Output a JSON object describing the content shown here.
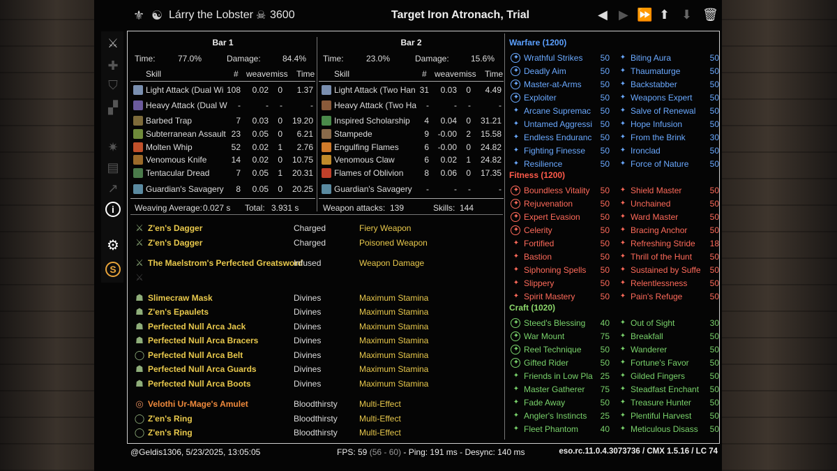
{
  "header": {
    "player": "Lárry the Lobster",
    "dps": "3600",
    "target": "Target Iron Atronach, Trial"
  },
  "colors": {
    "blue": "#6aa9ff",
    "red": "#ff6a5a",
    "green": "#79d26b",
    "gold": "#e9c94c",
    "orange": "#f08a3c",
    "header_blue": "#5ba0ff",
    "header_red": "#ff5a4a",
    "header_green": "#8cd86b"
  },
  "bars": [
    {
      "title": "Bar 1",
      "time_label": "Time:",
      "time": "77.0%",
      "damage_label": "Damage:",
      "damage": "84.4%",
      "cols": [
        "Skill",
        "#",
        "weave",
        "miss",
        "Time"
      ],
      "skills": [
        {
          "name": "Light Attack (Dual Wi",
          "n": "108",
          "weave": "0.02",
          "miss": "0",
          "time": "1.37",
          "color": "#7a8fb0"
        },
        {
          "name": "Heavy Attack (Dual W",
          "n": "-",
          "weave": "-",
          "miss": "-",
          "time": "-",
          "color": "#6b5a9c"
        },
        {
          "name": "Barbed Trap",
          "n": "7",
          "weave": "0.03",
          "miss": "0",
          "time": "19.20",
          "color": "#7d6a3a"
        },
        {
          "name": "Subterranean Assault",
          "n": "23",
          "weave": "0.05",
          "miss": "0",
          "time": "6.21",
          "color": "#6f8a3a"
        },
        {
          "name": "Molten Whip",
          "n": "52",
          "weave": "0.02",
          "miss": "1",
          "time": "2.76",
          "color": "#c0502a"
        },
        {
          "name": "Venomous Knife",
          "n": "14",
          "weave": "0.02",
          "miss": "0",
          "time": "10.75",
          "color": "#9a6a2a"
        },
        {
          "name": "Tentacular Dread",
          "n": "7",
          "weave": "0.05",
          "miss": "1",
          "time": "20.31",
          "color": "#4a7a4a"
        },
        {
          "name": "Guardian's Savagery",
          "n": "8",
          "weave": "0.05",
          "miss": "0",
          "time": "20.25",
          "color": "#5a8aa0"
        }
      ],
      "footer_a_label": "Weaving Average:",
      "footer_a": "0.027 s",
      "footer_b_label": "Total:",
      "footer_b": "3.931 s"
    },
    {
      "title": "Bar 2",
      "time_label": "Time:",
      "time": "23.0%",
      "damage_label": "Damage:",
      "damage": "15.6%",
      "cols": [
        "Skill",
        "#",
        "weave",
        "miss",
        "Time"
      ],
      "skills": [
        {
          "name": "Light Attack (Two Han",
          "n": "31",
          "weave": "0.03",
          "miss": "0",
          "time": "4.49",
          "color": "#7a8fb0"
        },
        {
          "name": "Heavy Attack (Two Ha",
          "n": "-",
          "weave": "-",
          "miss": "-",
          "time": "-",
          "color": "#8a5a3a"
        },
        {
          "name": "Inspired Scholarship",
          "n": "4",
          "weave": "0.04",
          "miss": "0",
          "time": "31.21",
          "color": "#4a8a4a"
        },
        {
          "name": "Stampede",
          "n": "9",
          "weave": "-0.00",
          "miss": "2",
          "time": "15.58",
          "color": "#8a6a4a"
        },
        {
          "name": "Engulfing Flames",
          "n": "6",
          "weave": "-0.00",
          "miss": "0",
          "time": "24.82",
          "color": "#d07a2a"
        },
        {
          "name": "Venomous Claw",
          "n": "6",
          "weave": "0.02",
          "miss": "1",
          "time": "24.82",
          "color": "#c08a2a"
        },
        {
          "name": "Flames of Oblivion",
          "n": "8",
          "weave": "0.06",
          "miss": "0",
          "time": "17.35",
          "color": "#c0402a"
        },
        {
          "name": "Guardian's Savagery",
          "n": "-",
          "weave": "-",
          "miss": "-",
          "time": "-",
          "color": "#5a8aa0"
        }
      ],
      "footer_a_label": "Weapon attacks:",
      "footer_a": "139",
      "footer_b_label": "Skills:",
      "footer_b": "144"
    }
  ],
  "gear": [
    {
      "name": "Z'en's Dagger",
      "trait": "Charged",
      "enchant": "Fiery Weapon",
      "color": "#e9c94c",
      "icon": "⚔"
    },
    {
      "name": "Z'en's Dagger",
      "trait": "Charged",
      "enchant": "Poisoned Weapon",
      "color": "#e9c94c",
      "icon": "⚔"
    },
    {
      "name": "The Maelstrom's Perfected Greatsword",
      "trait": "Infused",
      "enchant": "Weapon Damage",
      "color": "#e9c94c",
      "icon": "⚔"
    },
    {
      "name": "Slimecraw Mask",
      "trait": "Divines",
      "enchant": "Maximum Stamina",
      "color": "#e9c94c",
      "icon": "☗"
    },
    {
      "name": "Z'en's Epaulets",
      "trait": "Divines",
      "enchant": "Maximum Stamina",
      "color": "#e9c94c",
      "icon": "☗"
    },
    {
      "name": "Perfected Null Arca Jack",
      "trait": "Divines",
      "enchant": "Maximum Stamina",
      "color": "#e9c94c",
      "icon": "☗"
    },
    {
      "name": "Perfected Null Arca Bracers",
      "trait": "Divines",
      "enchant": "Maximum Stamina",
      "color": "#e9c94c",
      "icon": "☗"
    },
    {
      "name": "Perfected Null Arca Belt",
      "trait": "Divines",
      "enchant": "Maximum Stamina",
      "color": "#e9c94c",
      "icon": "◯"
    },
    {
      "name": "Perfected Null Arca Guards",
      "trait": "Divines",
      "enchant": "Maximum Stamina",
      "color": "#e9c94c",
      "icon": "☗"
    },
    {
      "name": "Perfected Null Arca Boots",
      "trait": "Divines",
      "enchant": "Maximum Stamina",
      "color": "#e9c94c",
      "icon": "☗"
    },
    {
      "name": "Velothi Ur-Mage's Amulet",
      "trait": "Bloodthirsty",
      "enchant": "Multi-Effect",
      "color": "#f08a3c",
      "icon": "◎"
    },
    {
      "name": "Z'en's Ring",
      "trait": "Bloodthirsty",
      "enchant": "Multi-Effect",
      "color": "#e9c94c",
      "icon": "◯"
    },
    {
      "name": "Z'en's Ring",
      "trait": "Bloodthirsty",
      "enchant": "Multi-Effect",
      "color": "#e9c94c",
      "icon": "◯"
    }
  ],
  "cp": [
    {
      "title": "Warfare (1200)",
      "color": "#6aa9ff",
      "hcolor": "#5ba0ff",
      "left": [
        [
          "Wrathful Strikes",
          "50",
          1
        ],
        [
          "Deadly Aim",
          "50",
          1
        ],
        [
          "Master-at-Arms",
          "50",
          1
        ],
        [
          "Exploiter",
          "50",
          1
        ],
        [
          "Arcane Supremac",
          "50",
          0
        ],
        [
          "Untamed Aggressi",
          "50",
          0
        ],
        [
          "Endless Enduranc",
          "50",
          0
        ],
        [
          "Fighting Finesse",
          "50",
          0
        ],
        [
          "Resilience",
          "50",
          0
        ]
      ],
      "right": [
        [
          "Biting Aura",
          "50",
          0
        ],
        [
          "Thaumaturge",
          "50",
          0
        ],
        [
          "Backstabber",
          "50",
          0
        ],
        [
          "Weapons Expert",
          "50",
          0
        ],
        [
          "Salve of Renewal",
          "50",
          0
        ],
        [
          "Hope Infusion",
          "50",
          0
        ],
        [
          "From the Brink",
          "30",
          0
        ],
        [
          "Ironclad",
          "50",
          0
        ],
        [
          "Force of Nature",
          "50",
          0
        ]
      ]
    },
    {
      "title": "Fitness (1200)",
      "color": "#ff6a5a",
      "hcolor": "#ff5a4a",
      "left": [
        [
          "Boundless Vitality",
          "50",
          1
        ],
        [
          "Rejuvenation",
          "50",
          1
        ],
        [
          "Expert Evasion",
          "50",
          1
        ],
        [
          "Celerity",
          "50",
          1
        ],
        [
          "Fortified",
          "50",
          0
        ],
        [
          "Bastion",
          "50",
          0
        ],
        [
          "Siphoning Spells",
          "50",
          0
        ],
        [
          "Slippery",
          "50",
          0
        ],
        [
          "Spirit Mastery",
          "50",
          0
        ]
      ],
      "right": [
        [
          "Shield Master",
          "50",
          0
        ],
        [
          "Unchained",
          "50",
          0
        ],
        [
          "Ward Master",
          "50",
          0
        ],
        [
          "Bracing Anchor",
          "50",
          0
        ],
        [
          "Refreshing Stride",
          "18",
          0
        ],
        [
          "Thrill of the Hunt",
          "50",
          0
        ],
        [
          "Sustained by Suffe",
          "50",
          0
        ],
        [
          "Relentlessness",
          "50",
          0
        ],
        [
          "Pain's Refuge",
          "50",
          0
        ]
      ]
    },
    {
      "title": "Craft (1020)",
      "color": "#79d26b",
      "hcolor": "#8cd86b",
      "left": [
        [
          "Steed's Blessing",
          "40",
          1
        ],
        [
          "War Mount",
          "75",
          1
        ],
        [
          "Reel Technique",
          "50",
          1
        ],
        [
          "Gifted Rider",
          "50",
          1
        ],
        [
          "Friends in Low Pla",
          "25",
          0
        ],
        [
          "Master Gatherer",
          "75",
          0
        ],
        [
          "Fade Away",
          "50",
          0
        ],
        [
          "Angler's Instincts",
          "25",
          0
        ],
        [
          "Fleet Phantom",
          "40",
          0
        ]
      ],
      "right": [
        [
          "Out of Sight",
          "30",
          0
        ],
        [
          "Breakfall",
          "50",
          0
        ],
        [
          "Wanderer",
          "50",
          0
        ],
        [
          "Fortune's Favor",
          "50",
          0
        ],
        [
          "Gilded Fingers",
          "50",
          0
        ],
        [
          "Steadfast Enchant",
          "50",
          0
        ],
        [
          "Treasure Hunter",
          "50",
          0
        ],
        [
          "Plentiful Harvest",
          "50",
          0
        ],
        [
          "Meticulous Disass",
          "50",
          0
        ]
      ]
    }
  ],
  "status": {
    "user": "@Geldis1306, 5/23/2025, 13:05:05",
    "fps_label": "FPS: 59",
    "fps_range": "(56 - 60)",
    "ping": "- Ping: 191 ms - Desync: 140 ms",
    "version": "eso.rc.11.0.4.3073736 / CMX 1.5.16 / LC 74"
  }
}
